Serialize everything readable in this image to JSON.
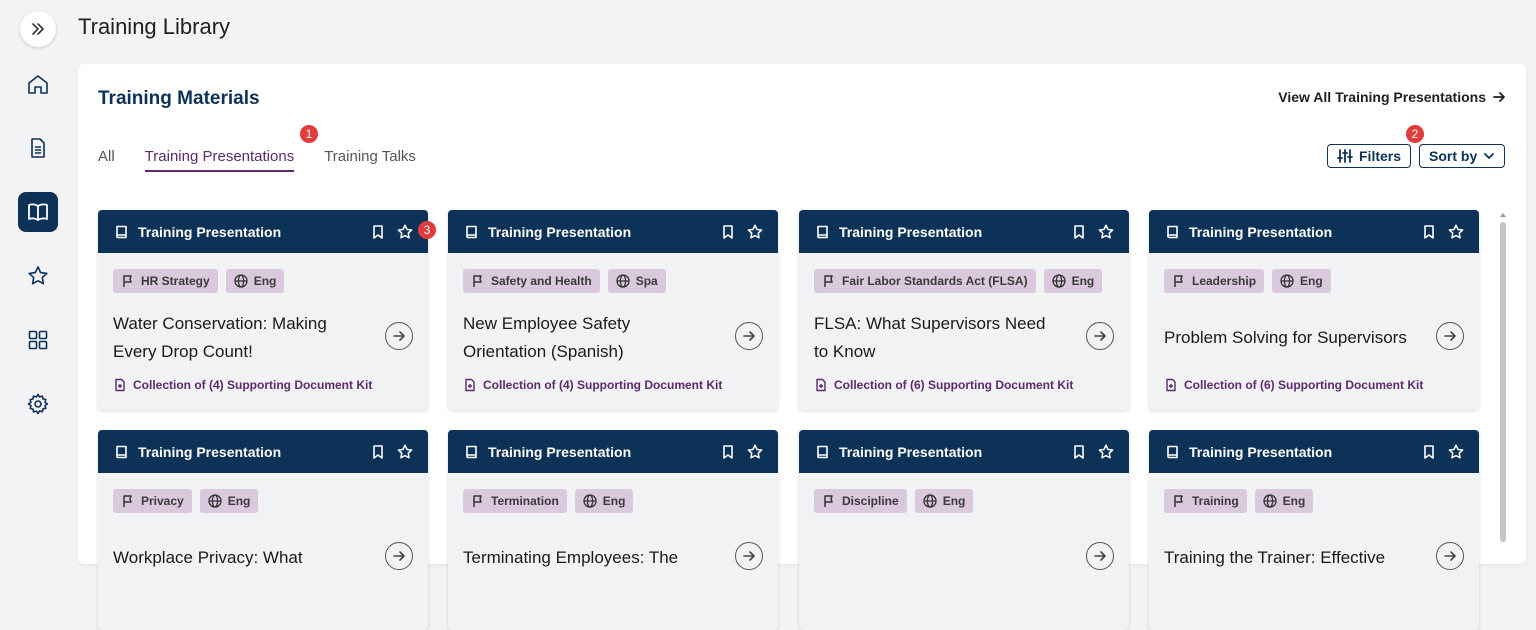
{
  "page": {
    "title": "Training Library"
  },
  "sidebar": {
    "items": [
      {
        "name": "home",
        "icon": "home-icon",
        "active": false
      },
      {
        "name": "documents",
        "icon": "document-icon",
        "active": false
      },
      {
        "name": "library",
        "icon": "book-icon",
        "active": true
      },
      {
        "name": "favorites",
        "icon": "star-icon",
        "active": false
      },
      {
        "name": "apps",
        "icon": "grid-icon",
        "active": false
      },
      {
        "name": "settings",
        "icon": "gear-icon",
        "active": false
      }
    ]
  },
  "section": {
    "title": "Training Materials",
    "view_all": "View All Training Presentations"
  },
  "tabs": [
    {
      "label": "All",
      "active": false
    },
    {
      "label": "Training Presentations",
      "active": true
    },
    {
      "label": "Training Talks",
      "active": false
    }
  ],
  "toolbar": {
    "filters_label": "Filters",
    "sort_label": "Sort by"
  },
  "badges": [
    "1",
    "2",
    "3"
  ],
  "cards": [
    {
      "type": "Training Presentation",
      "category": "HR Strategy",
      "language": "Eng",
      "title": "Water Conservation: Making Every Drop Count!",
      "kit": "Collection of (4) Supporting Document Kit"
    },
    {
      "type": "Training Presentation",
      "category": "Safety and Health",
      "language": "Spa",
      "title": "New Employee Safety Orientation (Spanish)",
      "kit": "Collection of (4) Supporting Document Kit"
    },
    {
      "type": "Training Presentation",
      "category": "Fair Labor Standards Act (FLSA)",
      "language": "Eng",
      "title": "FLSA: What Supervisors Need to Know",
      "kit": "Collection of (6) Supporting Document Kit"
    },
    {
      "type": "Training Presentation",
      "category": "Leadership",
      "language": "Eng",
      "title": "Problem Solving for Supervisors",
      "kit": "Collection of (6) Supporting Document Kit"
    },
    {
      "type": "Training Presentation",
      "category": "Privacy",
      "language": "Eng",
      "title": "Workplace Privacy: What",
      "kit": ""
    },
    {
      "type": "Training Presentation",
      "category": "Termination",
      "language": "Eng",
      "title": "Terminating Employees: The",
      "kit": ""
    },
    {
      "type": "Training Presentation",
      "category": "Discipline",
      "language": "Eng",
      "title": "",
      "kit": ""
    },
    {
      "type": "Training Presentation",
      "category": "Training",
      "language": "Eng",
      "title": "Training the Trainer: Effective",
      "kit": ""
    }
  ],
  "colors": {
    "navy": "#0d3258",
    "purple": "#5c2a6e",
    "pill": "#dac8dc",
    "badge": "#e03c3c"
  }
}
